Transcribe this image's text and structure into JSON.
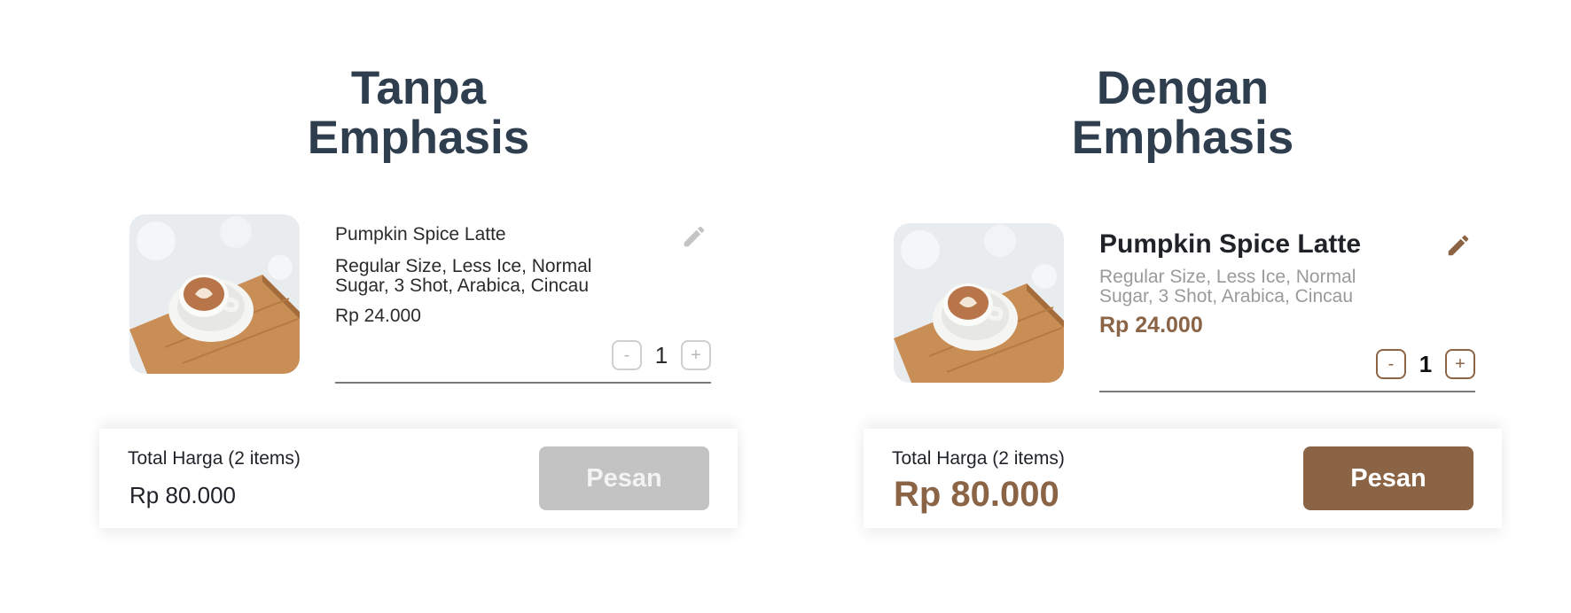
{
  "panels": [
    {
      "title_line1": "Tanpa",
      "title_line2": "Emphasis",
      "product_name": "Pumpkin Spice Latte",
      "product_desc_line1": "Regular Size, Less Ice, Normal",
      "product_desc_line2": "Sugar, 3 Shot, Arabica, Cincau",
      "product_price": "Rp 24.000",
      "qty_minus": "-",
      "qty_value": "1",
      "qty_plus": "+",
      "total_label": "Total Harga (2 items)",
      "total_value": "Rp 80.000",
      "order_label": "Pesan",
      "edit_icon": "pencil-icon",
      "edit_color": "#c4c4c4"
    },
    {
      "title_line1": "Dengan",
      "title_line2": "Emphasis",
      "product_name": "Pumpkin Spice Latte",
      "product_desc_line1": "Regular Size, Less Ice, Normal",
      "product_desc_line2": "Sugar, 3 Shot, Arabica, Cincau",
      "product_price": "Rp 24.000",
      "qty_minus": "-",
      "qty_value": "1",
      "qty_plus": "+",
      "total_label": "Total Harga (2 items)",
      "total_value": "Rp 80.000",
      "order_label": "Pesan",
      "edit_icon": "pencil-icon",
      "edit_color": "#8b6446"
    }
  ],
  "colors": {
    "title": "#2f3e4e",
    "accent_brown": "#8b6446",
    "disabled_button": "#c3c3c3",
    "muted_text": "#9a9a9a"
  }
}
